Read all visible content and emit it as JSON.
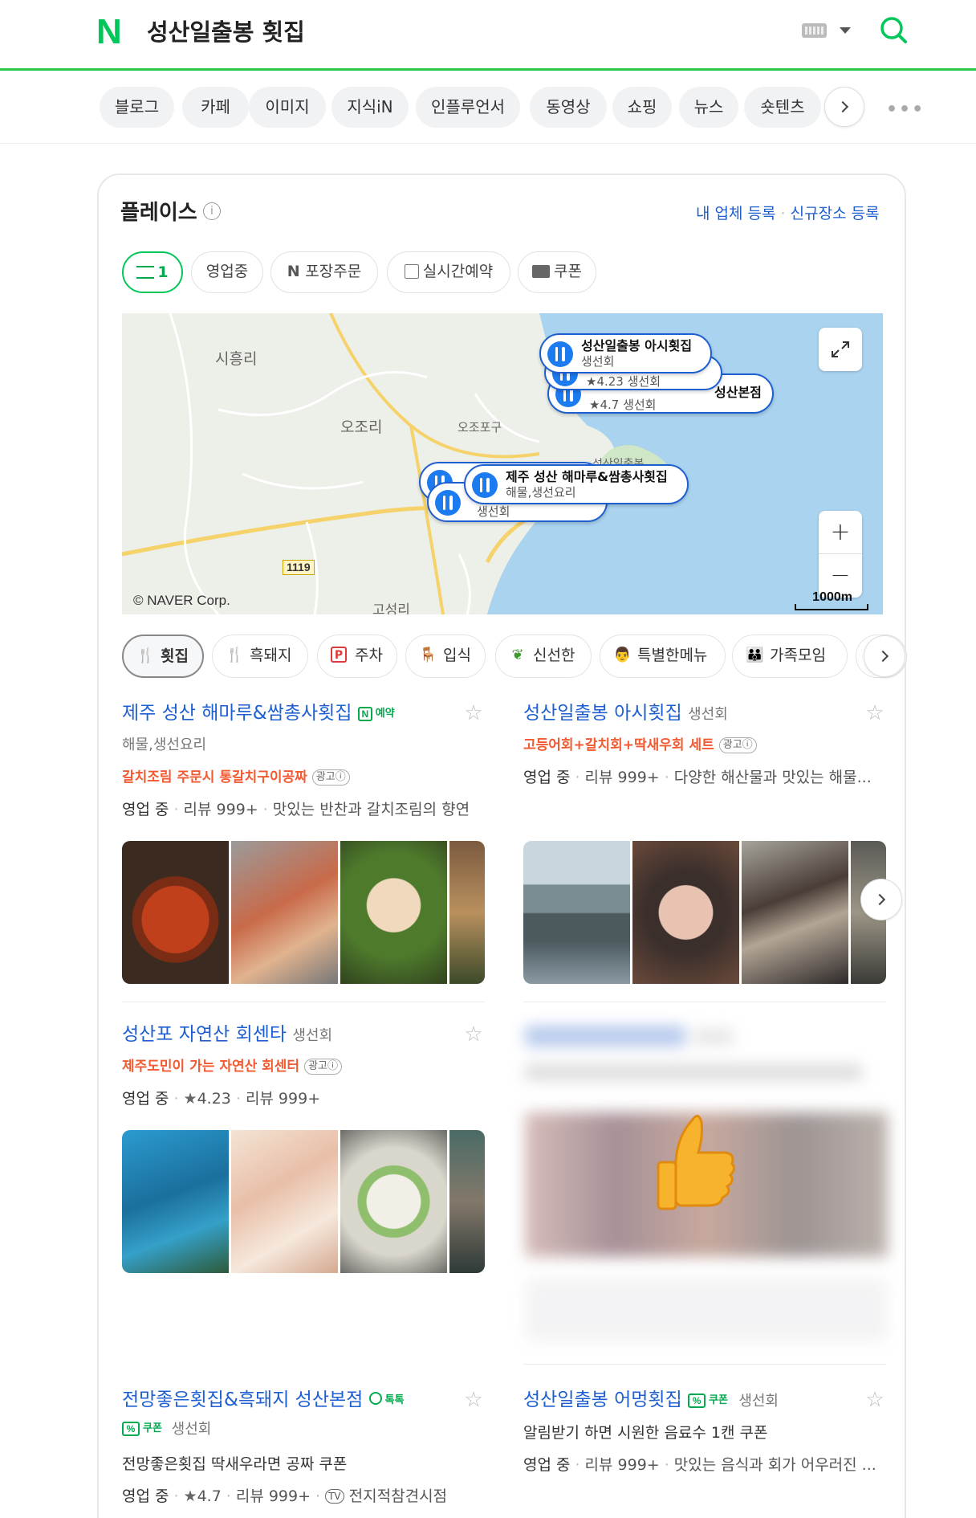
{
  "header": {
    "logo": "N",
    "query": "성산일출봉 횟집"
  },
  "tabs": [
    "블로그",
    "카페",
    "이미지",
    "지식iN",
    "인플루언서",
    "동영상",
    "쇼핑",
    "뉴스",
    "숏텐츠"
  ],
  "places": {
    "title": "플레이스",
    "info_symbol": "i",
    "register_business": "내 업체 등록",
    "register_sep": "·",
    "register_new": "신규장소 등록",
    "filters": {
      "count": "1",
      "open": "영업중",
      "takeout": "포장주문",
      "reservation": "실시간예약",
      "coupon": "쿠폰"
    }
  },
  "map": {
    "labels": {
      "sihung": "시흥리",
      "ojo": "오조리",
      "ojopo": "오조포구",
      "peak": "성산일출봉",
      "goseong": "고성리",
      "road": "1119"
    },
    "pins": [
      {
        "name": "성산일출봉 아시횟집",
        "cat": "생선회"
      },
      {
        "name": "성산본점",
        "cat": "★4.7  생선회"
      },
      {
        "name": "",
        "cat": "★4.23  생선회"
      },
      {
        "name": "제주 성산 해마루&쌈총사횟집",
        "cat": "해물,생선요리"
      },
      {
        "name": "",
        "cat": "생선회"
      }
    ],
    "copyright": "© NAVER Corp.",
    "scale": "1000m",
    "zoom_in": "+",
    "zoom_out": "−"
  },
  "categories": [
    "횟집",
    "흑돼지",
    "주차",
    "입식",
    "신선한",
    "특별한메뉴",
    "가족모임"
  ],
  "listings": [
    {
      "name": "제주 성산 해마루&쌈총사횟집",
      "badge": "예약",
      "badge_icon": "N",
      "sub": "해물,생선요리",
      "promo": "갈치조림 주문시 통갈치구이공짜",
      "ad": "광고ⓘ",
      "status": "영업 중",
      "review": "리뷰 999+",
      "desc": "맛있는 반찬과 갈치조림의 향연"
    },
    {
      "name": "성산일출봉 아시횟집",
      "cat": "생선회",
      "promo": "고등어회+갈치회+딱새우회 세트",
      "ad": "광고ⓘ",
      "status": "영업 중",
      "review": "리뷰 999+",
      "desc": "다양한 해산물과 맛있는 해물..."
    },
    {
      "name": "성산포 자연산 회센타",
      "cat": "생선회",
      "promo": "제주도민이 가는 자연산 회센터",
      "ad": "광고ⓘ",
      "status": "영업 중",
      "rating": "4.23",
      "review": "리뷰 999+"
    },
    {
      "name": "전망좋은횟집&흑돼지 성산본점",
      "badge": "톡톡",
      "coupon": "쿠폰",
      "cat": "생선회",
      "promo": "전망좋은횟집 딱새우라면 공짜 쿠폰",
      "status": "영업 중",
      "rating": "4.7",
      "review": "리뷰 999+",
      "tv": "TV",
      "tvshow": "전지적참견시점"
    },
    {
      "name": "성산일출봉 어멍횟집",
      "coupon": "쿠폰",
      "cat": "생선회",
      "promo": "알림받기 하면 시원한 음료수 1캔 쿠폰",
      "status": "영업 중",
      "review": "리뷰 999+",
      "desc": "맛있는 음식과 회가 어우러진 ..."
    }
  ],
  "icons": {
    "search": "search-icon",
    "keyboard": "keyboard-icon",
    "star": "star-icon",
    "expand": "expand-icon"
  },
  "colors": {
    "naver_green": "#03c75a",
    "link_blue": "#1d5fd0",
    "promo_orange": "#f25a31",
    "map_sea": "#a9d3ef"
  }
}
